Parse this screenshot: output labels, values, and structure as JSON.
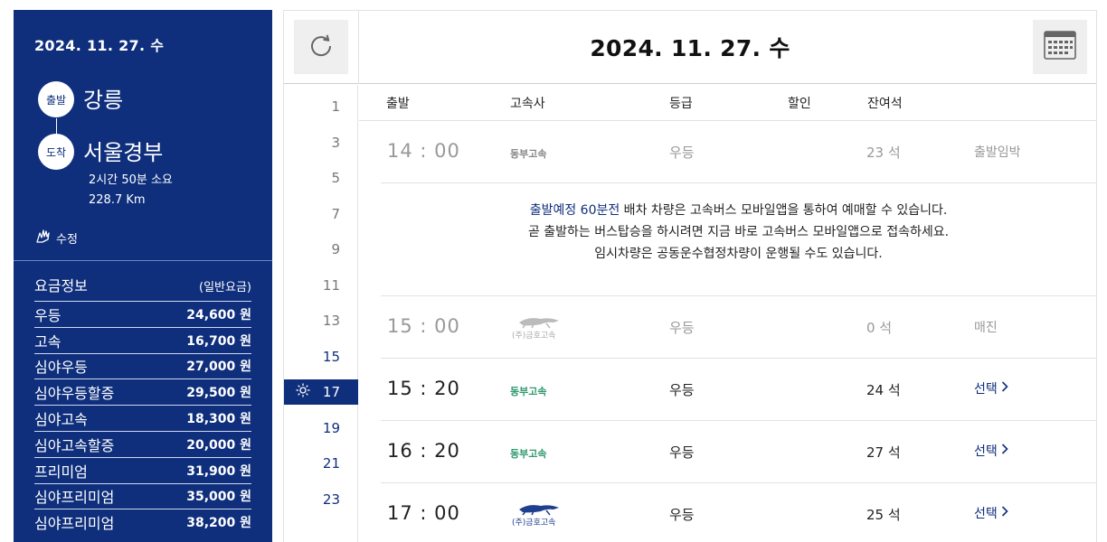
{
  "sidebar": {
    "date": "2024. 11. 27. 수",
    "departure_badge": "출발",
    "departure": "강릉",
    "arrival_badge": "도착",
    "arrival": "서울경부",
    "duration": "2시간 50분 소요",
    "distance": "228.7 Km",
    "edit_label": "수정",
    "fare_title": "요금정보",
    "fare_subtitle": "(일반요금)",
    "fares": [
      {
        "name": "우등",
        "amount": "24,600 원"
      },
      {
        "name": "고속",
        "amount": "16,700 원"
      },
      {
        "name": "심야우등",
        "amount": "27,000 원"
      },
      {
        "name": "심야우등할증",
        "amount": "29,500 원"
      },
      {
        "name": "심야고속",
        "amount": "18,300 원"
      },
      {
        "name": "심야고속할증",
        "amount": "20,000 원"
      },
      {
        "name": "프리미엄",
        "amount": "31,900 원"
      },
      {
        "name": "심야프리미엄",
        "amount": "35,000 원"
      },
      {
        "name": "심야프리미엄",
        "amount": "38,200 원"
      }
    ]
  },
  "header": {
    "date": "2024. 11. 27. 수",
    "refresh_icon": "refresh-icon",
    "calendar_icon": "calendar-icon"
  },
  "hours": [
    "1",
    "3",
    "5",
    "7",
    "9",
    "11",
    "13",
    "15",
    "17",
    "19",
    "21",
    "23"
  ],
  "active_hour": "17",
  "columns": {
    "depart": "출발",
    "company": "고속사",
    "grade": "등급",
    "discount": "할인",
    "seats": "잔여석"
  },
  "schedule": [
    {
      "time": "14 : 00",
      "company": "동부고속",
      "grade": "우등",
      "seats": "23 석",
      "status": "출발임박"
    },
    {
      "time": "15 : 00",
      "company": "(주)금호고속",
      "grade": "우등",
      "seats": "0 석",
      "status": "매진"
    },
    {
      "time": "15 : 20",
      "company": "동부고속",
      "grade": "우등",
      "seats": "24 석",
      "status": "선택"
    },
    {
      "time": "16 : 20",
      "company": "동부고속",
      "grade": "우등",
      "seats": "27 석",
      "status": "선택"
    },
    {
      "time": "17 : 00",
      "company": "(주)금호고속",
      "grade": "우등",
      "seats": "25 석",
      "status": "선택"
    }
  ],
  "notice": {
    "highlight": "출발예정 60분전",
    "line1_rest": " 배차 차량은 고속버스 모바일앱을 통하여 예매할 수 있습니다.",
    "line2": "곧 출발하는 버스탑승을 하시려면 지금 바로 고속버스 모바일앱으로 접속하세요.",
    "line3": "임시차량은 공동운수협정차량이 운행될 수도 있습니다."
  },
  "colors": {
    "brand_navy": "#0f2f7c",
    "dongbu_green": "#2f9a6e",
    "dim_text": "#999999"
  }
}
